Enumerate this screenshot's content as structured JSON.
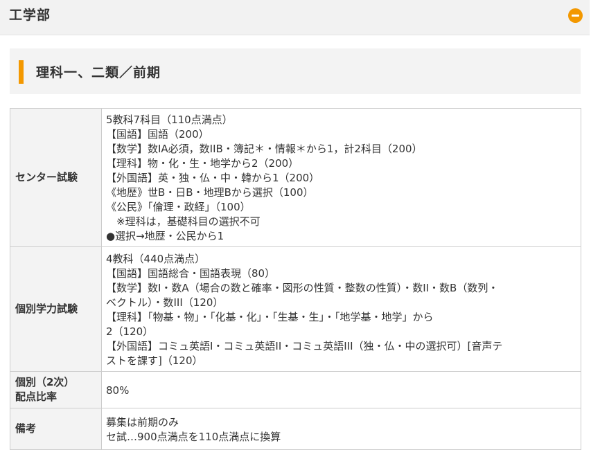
{
  "faculty": {
    "title": "工学部"
  },
  "section": {
    "title": "理科一、二類／前期"
  },
  "table": {
    "rows": [
      {
        "label": "センター試験",
        "lines": [
          "5教科7科目（110点満点）",
          "【国語】国語（200）",
          "【数学】数IA必須，数IIB・簿記＊・情報＊から1，計2科目（200）",
          "【理科】物・化・生・地学から2（200）",
          "【外国語】英・独・仏・中・韓から1（200）",
          "《地歴》世B・日B・地理Bから選択（100）",
          "《公民》「倫理・政経」（100）",
          "　※理科は，基礎科目の選択不可",
          "●選択→地歴・公民から1"
        ]
      },
      {
        "label": "個別学力試験",
        "lines": [
          "4教科（440点満点）",
          "【国語】国語総合・国語表現（80）",
          "【数学】数I・数A（場合の数と確率・図形の性質・整数の性質）・数II・数B（数列・",
          "ベクトル）・数III（120）",
          "【理科】「物基・物」・「化基・化」・「生基・生」・「地学基・地学」から",
          "2（120）",
          "【外国語】コミュ英語I・コミュ英語II・コミュ英語III（独・仏・中の選択可）[音声テ",
          "ストを課す]（120）"
        ]
      },
      {
        "label_lines": [
          "個別（2次）",
          "配点比率"
        ],
        "lines": [
          "80%"
        ]
      },
      {
        "label": "備考",
        "lines": [
          "募集は前期のみ",
          "セ試…900点満点を110点満点に換算"
        ]
      }
    ]
  },
  "colors": {
    "accent": "#f39800",
    "header_bg": "#f2f2f2",
    "border": "#cccccc"
  },
  "icons": {
    "collapse": "minus-circle-icon"
  }
}
